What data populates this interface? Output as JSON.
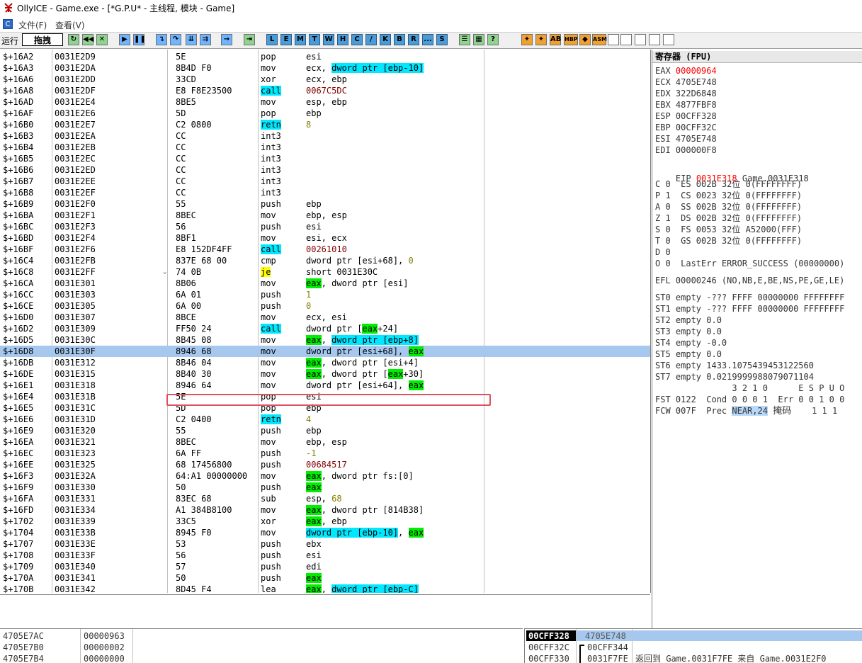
{
  "window": {
    "title": "OllyICE - Game.exe - [*G.P.U* -  主线程, 模块 - Game]",
    "icon": "bug-icon"
  },
  "menu": {
    "items": [
      {
        "label": "文件(F)"
      },
      {
        "label": "查看(V)"
      }
    ]
  },
  "toolbar": {
    "run_label": "运行",
    "drag_label": "拖拽",
    "letters": [
      "L",
      "E",
      "M",
      "T",
      "W",
      "H",
      "C",
      "/",
      "K",
      "B",
      "R",
      "...",
      "S"
    ],
    "extra": [
      "HBP",
      "ASM"
    ]
  },
  "disasm": {
    "rows": [
      {
        "label": "$+16A2",
        "addr": "0031E2D9",
        "hex": "5E",
        "mn": "pop",
        "ops": [
          {
            "t": "esi"
          }
        ]
      },
      {
        "label": "$+16A3",
        "addr": "0031E2DA",
        "hex": "8B4D F0",
        "mn": "mov",
        "ops": [
          {
            "t": "ecx, "
          },
          {
            "t": "dword ptr [ebp-10]",
            "c": "hl-c"
          }
        ]
      },
      {
        "label": "$+16A6",
        "addr": "0031E2DD",
        "hex": "33CD",
        "mn": "xor",
        "ops": [
          {
            "t": "ecx, ebp"
          }
        ]
      },
      {
        "label": "$+16A8",
        "addr": "0031E2DF",
        "hex": "E8 F8E23500",
        "mn": "call",
        "mnc": "hl-c",
        "ops": [
          {
            "t": "0067C5DC",
            "c": "far"
          }
        ]
      },
      {
        "label": "$+16AD",
        "addr": "0031E2E4",
        "hex": "8BE5",
        "mn": "mov",
        "ops": [
          {
            "t": "esp, ebp"
          }
        ]
      },
      {
        "label": "$+16AF",
        "addr": "0031E2E6",
        "hex": "5D",
        "mn": "pop",
        "ops": [
          {
            "t": "ebp"
          }
        ]
      },
      {
        "label": "$+16B0",
        "addr": "0031E2E7",
        "hex": "C2 0800",
        "mn": "retn",
        "mnc": "hl-c",
        "ops": [
          {
            "t": "8",
            "c": "num"
          }
        ]
      },
      {
        "label": "$+16B3",
        "addr": "0031E2EA",
        "hex": "CC",
        "mn": "int3",
        "ops": []
      },
      {
        "label": "$+16B4",
        "addr": "0031E2EB",
        "hex": "CC",
        "mn": "int3",
        "ops": []
      },
      {
        "label": "$+16B5",
        "addr": "0031E2EC",
        "hex": "CC",
        "mn": "int3",
        "ops": []
      },
      {
        "label": "$+16B6",
        "addr": "0031E2ED",
        "hex": "CC",
        "mn": "int3",
        "ops": []
      },
      {
        "label": "$+16B7",
        "addr": "0031E2EE",
        "hex": "CC",
        "mn": "int3",
        "ops": []
      },
      {
        "label": "$+16B8",
        "addr": "0031E2EF",
        "hex": "CC",
        "mn": "int3",
        "ops": []
      },
      {
        "label": "$+16B9",
        "addr": "0031E2F0",
        "hex": "55",
        "mn": "push",
        "ops": [
          {
            "t": "ebp"
          }
        ]
      },
      {
        "label": "$+16BA",
        "addr": "0031E2F1",
        "hex": "8BEC",
        "mn": "mov",
        "ops": [
          {
            "t": "ebp, esp"
          }
        ]
      },
      {
        "label": "$+16BC",
        "addr": "0031E2F3",
        "hex": "56",
        "mn": "push",
        "ops": [
          {
            "t": "esi"
          }
        ]
      },
      {
        "label": "$+16BD",
        "addr": "0031E2F4",
        "hex": "8BF1",
        "mn": "mov",
        "ops": [
          {
            "t": "esi, ecx"
          }
        ]
      },
      {
        "label": "$+16BF",
        "addr": "0031E2F6",
        "hex": "E8 152DF4FF",
        "mn": "call",
        "mnc": "hl-c",
        "ops": [
          {
            "t": "00261010",
            "c": "far"
          }
        ]
      },
      {
        "label": "$+16C4",
        "addr": "0031E2FB",
        "hex": "837E 68 00",
        "mn": "cmp",
        "ops": [
          {
            "t": "dword ptr [esi+68], "
          },
          {
            "t": "0",
            "c": "num"
          }
        ]
      },
      {
        "label": "$+16C8",
        "addr": "0031E2FF",
        "hex": "74 0B",
        "arrow": "⌄",
        "mn": "je",
        "mnc": "hl-y",
        "ops": [
          {
            "t": "short 0031E30C"
          }
        ]
      },
      {
        "label": "$+16CA",
        "addr": "0031E301",
        "hex": "8B06",
        "mn": "mov",
        "ops": [
          {
            "t": "eax",
            "c": "hl-g"
          },
          {
            "t": ", dword ptr [esi]"
          }
        ]
      },
      {
        "label": "$+16CC",
        "addr": "0031E303",
        "hex": "6A 01",
        "mn": "push",
        "ops": [
          {
            "t": "1",
            "c": "num"
          }
        ]
      },
      {
        "label": "$+16CE",
        "addr": "0031E305",
        "hex": "6A 00",
        "mn": "push",
        "ops": [
          {
            "t": "0",
            "c": "num"
          }
        ]
      },
      {
        "label": "$+16D0",
        "addr": "0031E307",
        "hex": "8BCE",
        "mn": "mov",
        "ops": [
          {
            "t": "ecx, esi"
          }
        ]
      },
      {
        "label": "$+16D2",
        "addr": "0031E309",
        "hex": "FF50 24",
        "mn": "call",
        "mnc": "hl-c",
        "ops": [
          {
            "t": "dword ptr ["
          },
          {
            "t": "eax",
            "c": "hl-g"
          },
          {
            "t": "+24]"
          }
        ]
      },
      {
        "label": "$+16D5",
        "addr": "0031E30C",
        "hex": "8B45 08",
        "mn": "mov",
        "ops": [
          {
            "t": "eax",
            "c": "hl-g"
          },
          {
            "t": ", "
          },
          {
            "t": "dword ptr [ebp+8]",
            "c": "hl-c"
          }
        ]
      },
      {
        "label": "$+16D8",
        "addr": "0031E30F",
        "hex": "8946 68",
        "mn": "mov",
        "sel": true,
        "ops": [
          {
            "t": "dword ptr [esi+68], "
          },
          {
            "t": "eax",
            "c": "hl-g"
          }
        ]
      },
      {
        "label": "$+16DB",
        "addr": "0031E312",
        "hex": "8B46 04",
        "mn": "mov",
        "ops": [
          {
            "t": "eax",
            "c": "hl-g"
          },
          {
            "t": ", dword ptr [esi+4]"
          }
        ]
      },
      {
        "label": "$+16DE",
        "addr": "0031E315",
        "hex": "8B40 30",
        "mn": "mov",
        "ops": [
          {
            "t": "eax",
            "c": "hl-g"
          },
          {
            "t": ", dword ptr ["
          },
          {
            "t": "eax",
            "c": "hl-g"
          },
          {
            "t": "+30]"
          }
        ]
      },
      {
        "label": "$+16E1",
        "addr": "0031E318",
        "hex": "8946 64",
        "mn": "mov",
        "ops": [
          {
            "t": "dword ptr [esi+64], "
          },
          {
            "t": "eax",
            "c": "hl-g"
          }
        ]
      },
      {
        "label": "$+16E4",
        "addr": "0031E31B",
        "hex": "5E",
        "mn": "pop",
        "ops": [
          {
            "t": "esi"
          }
        ]
      },
      {
        "label": "$+16E5",
        "addr": "0031E31C",
        "hex": "5D",
        "mn": "pop",
        "ops": [
          {
            "t": "ebp"
          }
        ]
      },
      {
        "label": "$+16E6",
        "addr": "0031E31D",
        "hex": "C2 0400",
        "mn": "retn",
        "mnc": "hl-c",
        "ops": [
          {
            "t": "4",
            "c": "num"
          }
        ]
      },
      {
        "label": "$+16E9",
        "addr": "0031E320",
        "hex": "55",
        "mn": "push",
        "ops": [
          {
            "t": "ebp"
          }
        ]
      },
      {
        "label": "$+16EA",
        "addr": "0031E321",
        "hex": "8BEC",
        "mn": "mov",
        "ops": [
          {
            "t": "ebp, esp"
          }
        ]
      },
      {
        "label": "$+16EC",
        "addr": "0031E323",
        "hex": "6A FF",
        "mn": "push",
        "ops": [
          {
            "t": "-1",
            "c": "num"
          }
        ]
      },
      {
        "label": "$+16EE",
        "addr": "0031E325",
        "hex": "68 17456800",
        "mn": "push",
        "ops": [
          {
            "t": "00684517",
            "c": "far"
          }
        ]
      },
      {
        "label": "$+16F3",
        "addr": "0031E32A",
        "hex": "64:A1 00000000",
        "mn": "mov",
        "ops": [
          {
            "t": "eax",
            "c": "hl-g"
          },
          {
            "t": ", dword ptr fs:[0]"
          }
        ]
      },
      {
        "label": "$+16F9",
        "addr": "0031E330",
        "hex": "50",
        "mn": "push",
        "ops": [
          {
            "t": "eax",
            "c": "hl-g"
          }
        ]
      },
      {
        "label": "$+16FA",
        "addr": "0031E331",
        "hex": "83EC 68",
        "mn": "sub",
        "ops": [
          {
            "t": "esp, "
          },
          {
            "t": "68",
            "c": "num"
          }
        ]
      },
      {
        "label": "$+16FD",
        "addr": "0031E334",
        "hex": "A1 384B8100",
        "mn": "mov",
        "ops": [
          {
            "t": "eax",
            "c": "hl-g"
          },
          {
            "t": ", dword ptr [814B38]"
          }
        ]
      },
      {
        "label": "$+1702",
        "addr": "0031E339",
        "hex": "33C5",
        "mn": "xor",
        "ops": [
          {
            "t": "eax",
            "c": "hl-g"
          },
          {
            "t": ", ebp"
          }
        ]
      },
      {
        "label": "$+1704",
        "addr": "0031E33B",
        "hex": "8945 F0",
        "mn": "mov",
        "ops": [
          {
            "t": "dword ptr [ebp-10]",
            "c": "hl-c"
          },
          {
            "t": ", "
          },
          {
            "t": "eax",
            "c": "hl-g"
          }
        ]
      },
      {
        "label": "$+1707",
        "addr": "0031E33E",
        "hex": "53",
        "mn": "push",
        "ops": [
          {
            "t": "ebx"
          }
        ]
      },
      {
        "label": "$+1708",
        "addr": "0031E33F",
        "hex": "56",
        "mn": "push",
        "ops": [
          {
            "t": "esi"
          }
        ]
      },
      {
        "label": "$+1709",
        "addr": "0031E340",
        "hex": "57",
        "mn": "push",
        "ops": [
          {
            "t": "edi"
          }
        ]
      },
      {
        "label": "$+170A",
        "addr": "0031E341",
        "hex": "50",
        "mn": "push",
        "ops": [
          {
            "t": "eax",
            "c": "hl-g"
          }
        ]
      },
      {
        "label": "$+170B",
        "addr": "0031E342",
        "hex": "8D45 F4",
        "mn": "lea",
        "ops": [
          {
            "t": "eax",
            "c": "hl-g"
          },
          {
            "t": ", "
          },
          {
            "t": "dword ptr [ebp-C]",
            "c": "hl-c"
          }
        ]
      }
    ]
  },
  "registers": {
    "header": "寄存器 (FPU)",
    "gp": [
      {
        "name": "EAX",
        "value": "00000964",
        "changed": true,
        "extra": ""
      },
      {
        "name": "ECX",
        "value": "4705E748",
        "changed": false,
        "extra": ""
      },
      {
        "name": "EDX",
        "value": "322D6848",
        "changed": false,
        "extra": ""
      },
      {
        "name": "EBX",
        "value": "4877FBF8",
        "changed": false,
        "extra": ""
      },
      {
        "name": "ESP",
        "value": "00CFF328",
        "changed": false,
        "extra": ""
      },
      {
        "name": "EBP",
        "value": "00CFF32C",
        "changed": false,
        "extra": ""
      },
      {
        "name": "ESI",
        "value": "4705E748",
        "changed": false,
        "extra": ""
      },
      {
        "name": "EDI",
        "value": "000000F8",
        "changed": false,
        "extra": ""
      }
    ],
    "eip": {
      "name": "EIP",
      "value": "0031E318",
      "extra": "Game.0031E318"
    },
    "flags": [
      "C 0  ES 002B 32位 0(FFFFFFFF)",
      "P 1  CS 0023 32位 0(FFFFFFFF)",
      "A 0  SS 002B 32位 0(FFFFFFFF)",
      "Z 1  DS 002B 32位 0(FFFFFFFF)",
      "S 0  FS 0053 32位 A52000(FFF)",
      "T 0  GS 002B 32位 0(FFFFFFFF)",
      "D 0",
      "O 0  LastErr ERROR_SUCCESS (00000000)"
    ],
    "efl": "EFL 00000246 (NO,NB,E,BE,NS,PE,GE,LE)",
    "fpu": [
      "ST0 empty -??? FFFF 00000000 FFFFFFFF",
      "ST1 empty -??? FFFF 00000000 FFFFFFFF",
      "ST2 empty 0.0",
      "ST3 empty 0.0",
      "ST4 empty -0.0",
      "ST5 empty 0.0",
      "ST6 empty 1433.1075439453122560",
      "ST7 empty 0.0219999988079071104"
    ],
    "fst_header": "               3 2 1 0      E S P U O",
    "fst": "FST 0122  Cond 0 0 0 1  Err 0 0 1 0 0",
    "fcw_prefix": "FCW 007F  Prec ",
    "fcw_prec": "NEAR,24",
    "fcw_mask_label": "掩码",
    "fcw_mask": "    1 1 1"
  },
  "dump": {
    "rows": [
      {
        "addr": "4705E7AC",
        "value": "00000963"
      },
      {
        "addr": "4705E7B0",
        "value": "00000002"
      },
      {
        "addr": "4705E7B4",
        "value": "00000000"
      }
    ]
  },
  "stack": {
    "rows": [
      {
        "addr": "00CFF328",
        "value": "4705E748",
        "comment": ""
      },
      {
        "addr": "00CFF32C",
        "value": "00CFF344",
        "comment": ""
      },
      {
        "addr": "00CFF330",
        "value": "0031F7FE",
        "comment": "返回到 Game.0031F7FE 来自 Game.0031E2F0"
      }
    ]
  }
}
